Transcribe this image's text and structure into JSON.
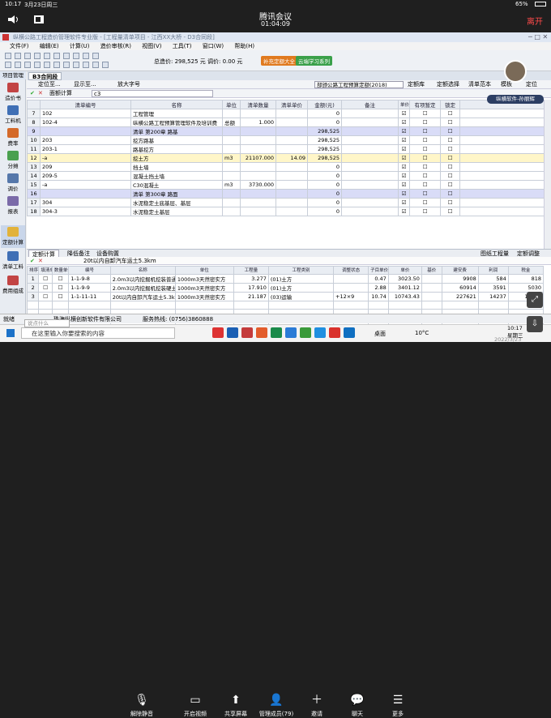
{
  "ios": {
    "time": "10:17",
    "date": "3月23日周三",
    "battery": "65%"
  },
  "meeting": {
    "title": "腾讯会议",
    "elapsed": "01:04:09",
    "leave": "离开"
  },
  "app": {
    "title": "纵横公路工程造价管理软件专业版 - [工程量清单项目 - 江西XX大桥 - D3合同段]",
    "menus": [
      "文件(F)",
      "编辑(E)",
      "计算(U)",
      "造价审核(R)",
      "视图(V)",
      "工具(T)",
      "窗口(W)",
      "帮助(H)"
    ],
    "total_label": "总造价: 298,525 元",
    "unit_price": "调价: 0.00 元",
    "pill1": "补充定额大全",
    "pill2": "云端学习系列",
    "nav": [
      {
        "label": "项目管理"
      },
      {
        "label": "造价书"
      },
      {
        "label": "工料机"
      },
      {
        "label": "费率"
      },
      {
        "label": "分摊"
      },
      {
        "label": "调价"
      },
      {
        "label": "报表"
      }
    ],
    "nav2": [
      {
        "label": "定额计算"
      },
      {
        "label": "清单工料"
      },
      {
        "label": "费用组成"
      }
    ],
    "project_tab": "B3合同段",
    "sub_toolbar": [
      "定位至...",
      "显示至...",
      "放大字号"
    ],
    "selector": "部颁公路工程预算定额(2018)",
    "right_btns": [
      "定额库",
      "定额选择",
      "清单范本",
      "模板",
      "定位"
    ],
    "row_toolbar": "面额计算",
    "row_input": "c3",
    "columns": [
      "清单编号",
      "名称",
      "单位",
      "清单数量",
      "清单单价",
      "金额(元)",
      "备注",
      "单价分析",
      "有项暂定",
      "锁定"
    ],
    "rows": [
      {
        "n": "7",
        "code": "102",
        "name": "工程管理",
        "unit": "",
        "qty": "",
        "price": "",
        "amt": "0",
        "style": ""
      },
      {
        "n": "8",
        "code": "102-4",
        "name": "纵横公路工程预算管理软件及培训费",
        "unit": "总额",
        "qty": "1.000",
        "price": "",
        "amt": "0",
        "style": ""
      },
      {
        "n": "9",
        "code": "",
        "name": "清单 第200章 路基",
        "unit": "",
        "qty": "",
        "price": "",
        "amt": "298,525",
        "style": "hl"
      },
      {
        "n": "10",
        "code": "203",
        "name": "挖方路基",
        "unit": "",
        "qty": "",
        "price": "",
        "amt": "298,525",
        "style": ""
      },
      {
        "n": "11",
        "code": "203-1",
        "name": "路基挖方",
        "unit": "",
        "qty": "",
        "price": "",
        "amt": "298,525",
        "style": ""
      },
      {
        "n": "12",
        "code": "-a",
        "name": "挖土方",
        "unit": "m3",
        "qty": "21107.000",
        "price": "14.09",
        "amt": "298,525",
        "style": "sel"
      },
      {
        "n": "13",
        "code": "209",
        "name": "挡土墙",
        "unit": "",
        "qty": "",
        "price": "",
        "amt": "0",
        "style": ""
      },
      {
        "n": "14",
        "code": "209-5",
        "name": "混凝土挡土墙",
        "unit": "",
        "qty": "",
        "price": "",
        "amt": "0",
        "style": ""
      },
      {
        "n": "15",
        "code": "-a",
        "name": "C30混凝土",
        "unit": "m3",
        "qty": "3730.000",
        "price": "",
        "amt": "0",
        "style": ""
      },
      {
        "n": "16",
        "code": "",
        "name": "清单 第300章 路面",
        "unit": "",
        "qty": "",
        "price": "",
        "amt": "0",
        "style": "hl"
      },
      {
        "n": "17",
        "code": "304",
        "name": "水泥稳定土底基层、基层",
        "unit": "",
        "qty": "",
        "price": "",
        "amt": "0",
        "style": ""
      },
      {
        "n": "18",
        "code": "304-3",
        "name": "水泥稳定土基层",
        "unit": "",
        "qty": "",
        "price": "",
        "amt": "0",
        "style": ""
      }
    ],
    "bottom_tabs": [
      "定额计算",
      "降低备注",
      "设备购置"
    ],
    "bottom_right": [
      "图纸工程量",
      "定额调整"
    ],
    "desc": "20t以内自卸汽车运土5.3km",
    "columns2": [
      "排序",
      "填清单",
      "数量单价",
      "编号",
      "名称",
      "单位",
      "工程量",
      "工程类别",
      "调整状态",
      "子目单价",
      "单价",
      "基价",
      "建安费",
      "利润",
      "税金"
    ],
    "rows2": [
      {
        "n": "1",
        "code": "1-1-9-8",
        "name": "2.0m3以内挖掘机挖装普通土",
        "unit": "1000m3天然密实方",
        "qty": "3.277",
        "cat": "(01)土方",
        "adj": "",
        "sub": "0.47",
        "up": "3023.50",
        "base": "",
        "build": "9908",
        "profit": "584",
        "tax": "818"
      },
      {
        "n": "2",
        "code": "1-1-9-9",
        "name": "2.0m3以内挖掘机挖装硬土",
        "unit": "1000m3天然密实方",
        "qty": "17.910",
        "cat": "(01)土方",
        "adj": "",
        "sub": "2.88",
        "up": "3401.12",
        "base": "",
        "build": "60914",
        "profit": "3591",
        "tax": "5030"
      },
      {
        "n": "3",
        "code": "1-1-11-11",
        "name": "20t以内自卸汽车运土5.3k",
        "unit": "1000m3天然密实方",
        "qty": "21.187",
        "cat": "(03)运输",
        "adj": "+12×9",
        "sub": "10.74",
        "up": "10743.43",
        "base": "",
        "build": "227621",
        "profit": "14237",
        "tax": "18794"
      }
    ],
    "status_left": "就绪",
    "status_company": "珠海纵横创新软件有限公司",
    "status_hotline": "服务热线: (0756)3860888"
  },
  "presenter": "纵横软件-孙丽辉",
  "taskbar": {
    "search": "在这里输入你要搜索的内容",
    "desktop": "桌面",
    "temp": "10°C",
    "clock": "10:17",
    "weekday": "星期三",
    "date": "2022/3/23",
    "popup": "说点什么"
  },
  "dock": [
    {
      "label": "解除静音",
      "icon": "mic-muted-icon"
    },
    {
      "label": "开启视频",
      "icon": "camera-off-icon"
    },
    {
      "label": "共享屏幕",
      "icon": "share-screen-icon"
    },
    {
      "label": "管理成员(79)",
      "icon": "members-icon"
    },
    {
      "label": "邀请",
      "icon": "invite-icon"
    },
    {
      "label": "聊天",
      "icon": "chat-icon"
    },
    {
      "label": "更多",
      "icon": "more-icon"
    }
  ]
}
